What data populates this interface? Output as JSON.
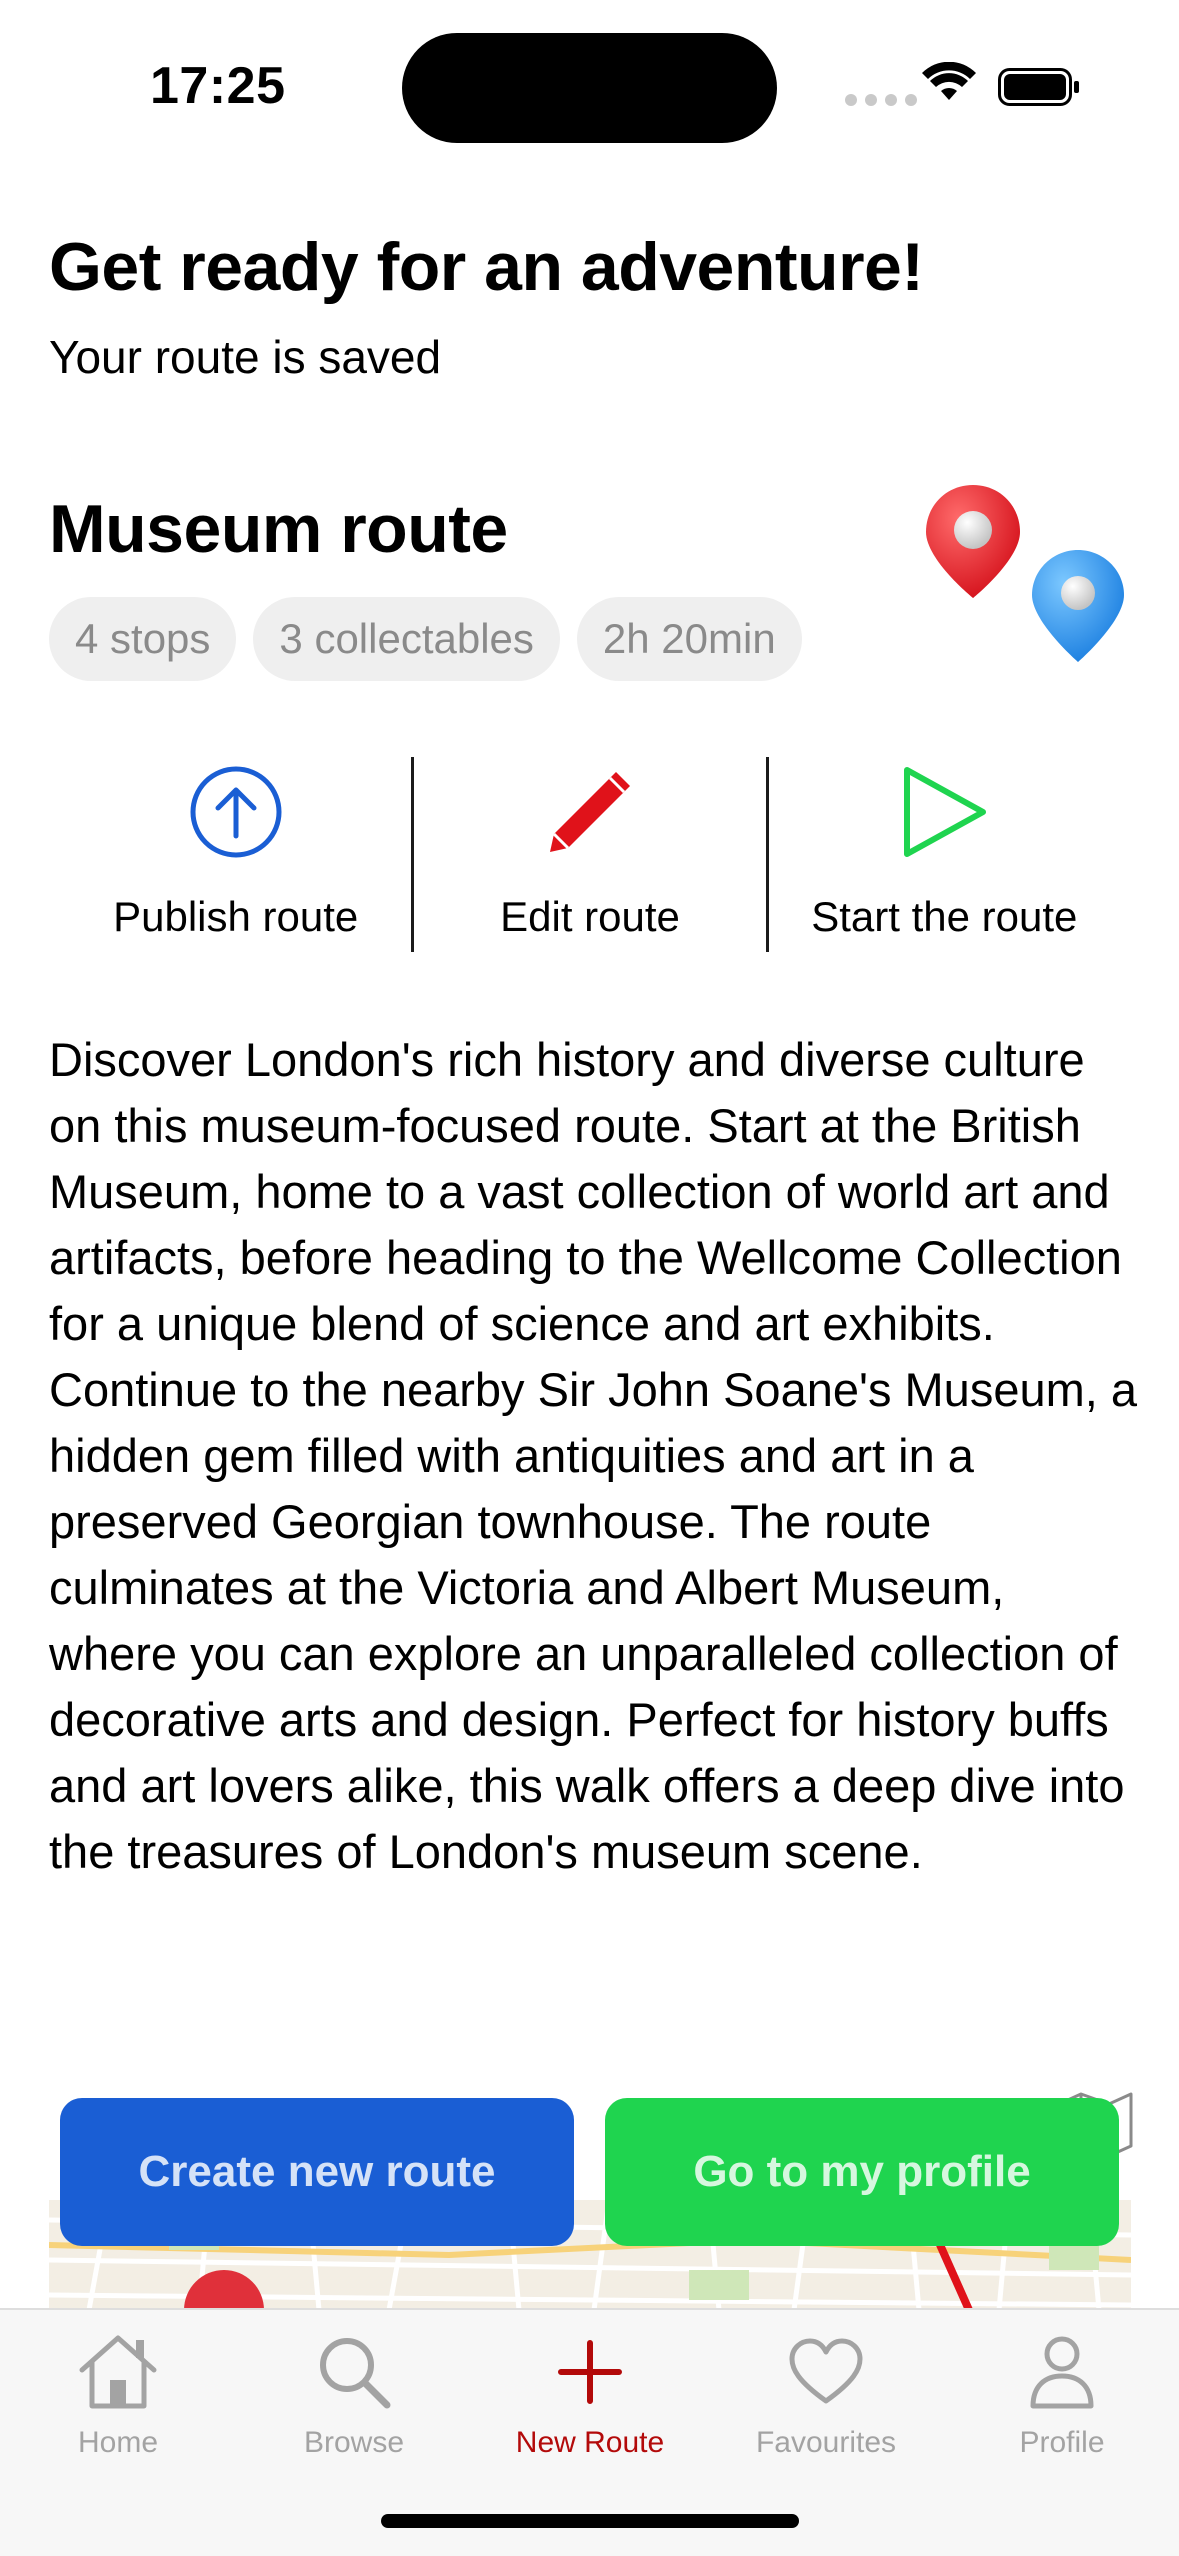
{
  "status": {
    "time": "17:25"
  },
  "header": {
    "title": "Get ready for an adventure!",
    "subtitle": "Your route is saved"
  },
  "route": {
    "name": "Museum route",
    "chips": [
      "4 stops",
      "3 collectables",
      "2h 20min"
    ]
  },
  "actions": {
    "publish": "Publish route",
    "edit": "Edit route",
    "start": "Start the route"
  },
  "description": "Discover London's rich history and diverse culture on this museum-focused route. Start at the British Museum, home to a vast collection of world art and artifacts, before heading to the Wellcome Collection for a unique blend of science and art exhibits. Continue to the nearby Sir John Soane's Museum, a hidden gem filled with antiquities and art in a preserved Georgian townhouse. The route culminates at the Victoria and Albert Museum, where you can explore an unparalleled collection of decorative arts and design. Perfect for history buffs and art lovers alike, this walk offers a deep dive into the treasures of London's museum scene.",
  "buttons": {
    "create": "Create new route",
    "profile": "Go to my profile"
  },
  "tabs": [
    {
      "label": "Home",
      "icon": "home-icon"
    },
    {
      "label": "Browse",
      "icon": "search-icon"
    },
    {
      "label": "New Route",
      "icon": "plus-icon"
    },
    {
      "label": "Favourites",
      "icon": "heart-icon"
    },
    {
      "label": "Profile",
      "icon": "person-icon"
    }
  ],
  "colors": {
    "primary_blue": "#1a5ed4",
    "primary_green": "#1fd44f",
    "active_tab": "#b30a0a",
    "edit_red": "#e0121a"
  }
}
